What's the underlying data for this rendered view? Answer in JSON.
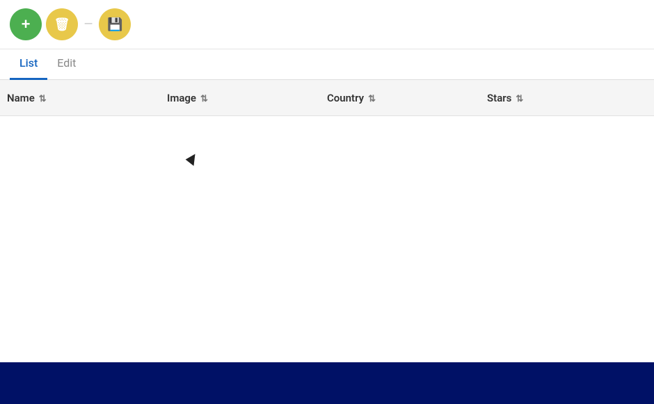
{
  "toolbar": {
    "add_label": "+",
    "delete_label": "🗑",
    "separator": "–",
    "save_label": "💾"
  },
  "tabs": [
    {
      "id": "list",
      "label": "List",
      "active": true
    },
    {
      "id": "edit",
      "label": "Edit",
      "active": false
    }
  ],
  "table": {
    "columns": [
      {
        "id": "name",
        "label": "Name"
      },
      {
        "id": "image",
        "label": "Image"
      },
      {
        "id": "country",
        "label": "Country"
      },
      {
        "id": "stars",
        "label": "Stars"
      }
    ],
    "rows": []
  },
  "footer": {
    "background": "#001166"
  }
}
